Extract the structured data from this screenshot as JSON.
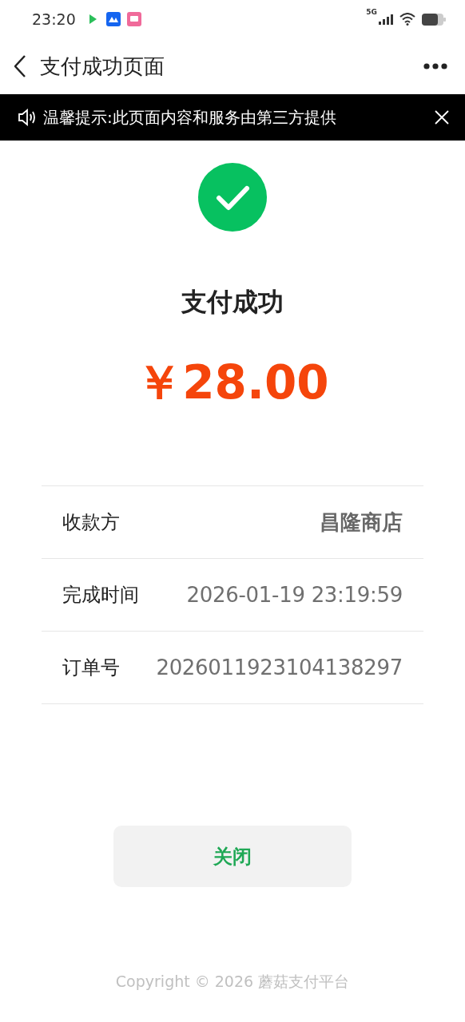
{
  "status_bar": {
    "time": "23:20",
    "network": "5G"
  },
  "nav": {
    "title": "支付成功页面"
  },
  "notice": {
    "text": "温馨提示:此页面内容和服务由第三方提供"
  },
  "result": {
    "title": "支付成功",
    "amount": "￥28.00"
  },
  "details": [
    {
      "label": "收款方",
      "value": "昌隆商店",
      "emphasis": true
    },
    {
      "label": "完成时间",
      "value": "2026-01-19 23:19:59",
      "emphasis": false
    },
    {
      "label": "订单号",
      "value": "2026011923104138297",
      "emphasis": false
    }
  ],
  "button": {
    "label": "关闭"
  },
  "footer": {
    "text": "Copyright © 2026 蘑菇支付平台"
  }
}
